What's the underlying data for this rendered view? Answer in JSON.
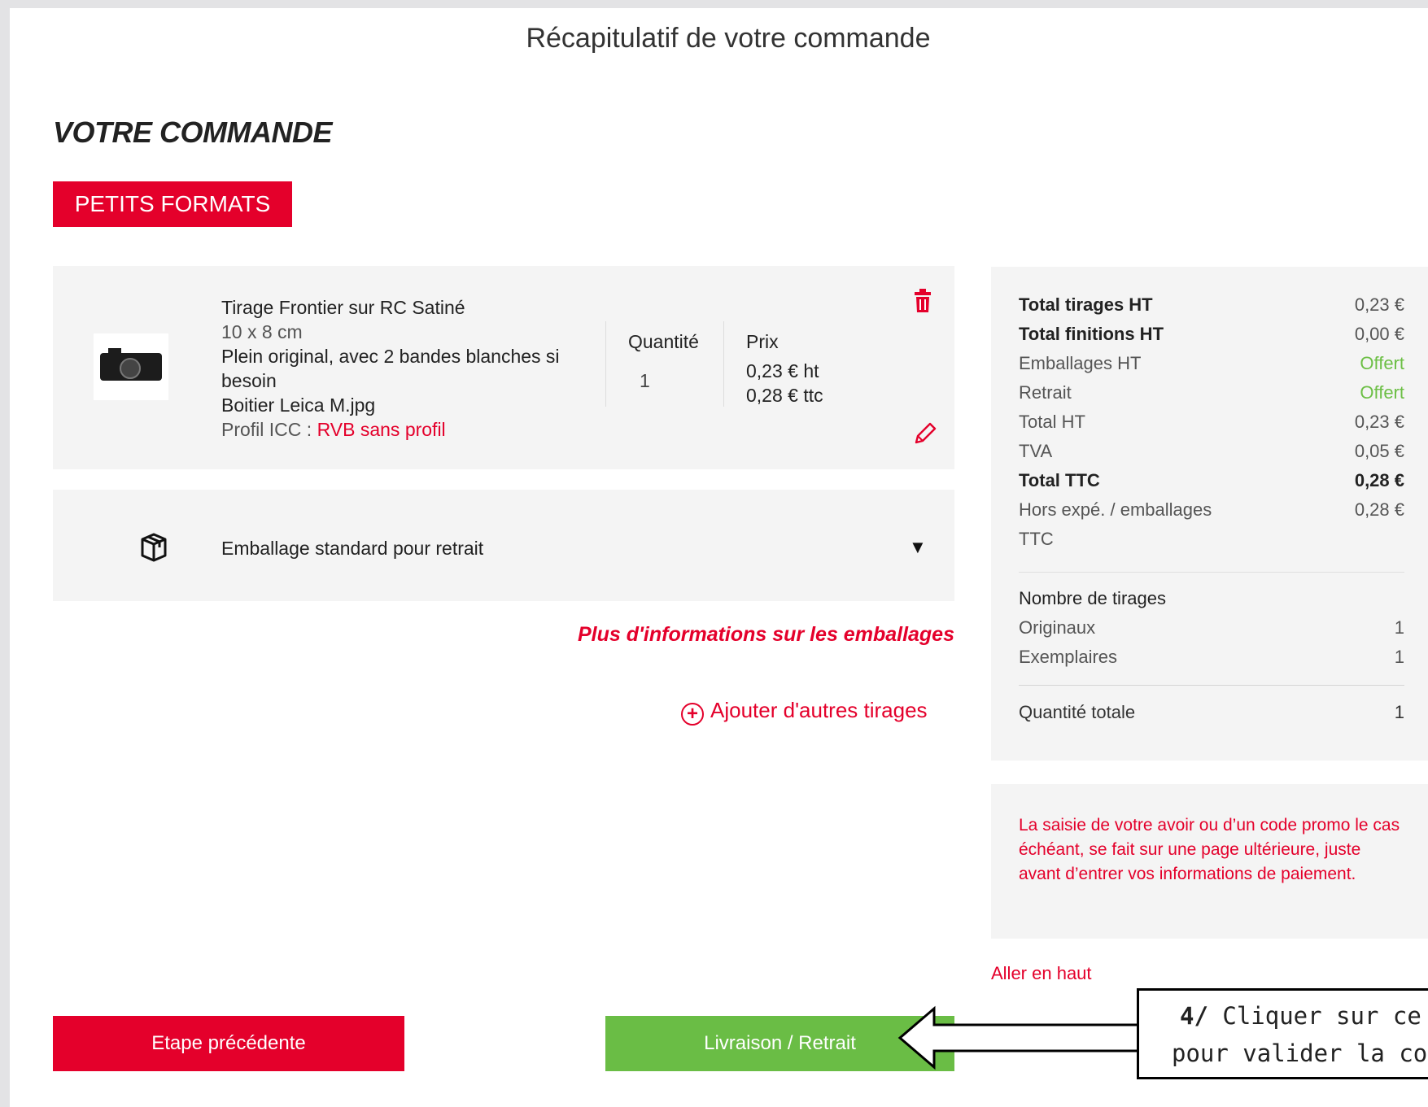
{
  "page_title": "Récapitulatif de votre commande",
  "section_title": "VOTRE COMMANDE",
  "category_tag": "PETITS FORMATS",
  "item": {
    "name": "Tirage Frontier sur RC Satiné",
    "size": "10 x 8 cm",
    "option": "Plein original, avec 2 bandes blanches si besoin",
    "filename": "Boitier Leica M.jpg",
    "icc_label": "Profil ICC : ",
    "icc_value": "RVB sans profil",
    "quantity_label": "Quantité",
    "quantity_value": "1",
    "price_label": "Prix",
    "price_ht": "0,23 € ht",
    "price_ttc": "0,28 € ttc"
  },
  "packaging": {
    "label": "Emballage standard pour retrait"
  },
  "links": {
    "packaging_info": "Plus d'informations sur les emballages",
    "add_prints": "Ajouter d'autres tirages",
    "go_top": "Aller en haut"
  },
  "summary": {
    "rows": [
      {
        "label": "Total tirages HT",
        "value": "0,23 €"
      },
      {
        "label": "Total finitions HT",
        "value": "0,00 €"
      },
      {
        "label": "Emballages HT",
        "value": "Offert"
      },
      {
        "label": "Retrait",
        "value": "Offert"
      },
      {
        "label": "Total HT",
        "value": "0,23 €"
      },
      {
        "label": "TVA",
        "value": "0,05 €"
      },
      {
        "label": "Total TTC",
        "value": "0,28 €"
      },
      {
        "label": "Hors expé. / emballages",
        "value": "0,28 €"
      },
      {
        "label": "TTC",
        "value": ""
      }
    ],
    "prints_heading": "Nombre de tirages",
    "originals_label": "Originaux",
    "originals_value": "1",
    "copies_label": "Exemplaires",
    "copies_value": "1",
    "total_qty_label": "Quantité totale",
    "total_qty_value": "1"
  },
  "promo_note": "La saisie de votre avoir ou d’un code promo le cas échéant, se fait sur une page ultérieure, juste avant d’entrer vos informations de paiement.",
  "buttons": {
    "previous": "Etape précédente",
    "next": "Livraison / Retrait"
  },
  "callout": {
    "step": "4/",
    "line1": " Cliquer sur ce",
    "line2": "pour valider la co"
  },
  "colors": {
    "brand_red": "#e4002b",
    "green": "#6abd45",
    "offert_green": "#6cbf45",
    "card_bg": "#f4f4f4"
  }
}
